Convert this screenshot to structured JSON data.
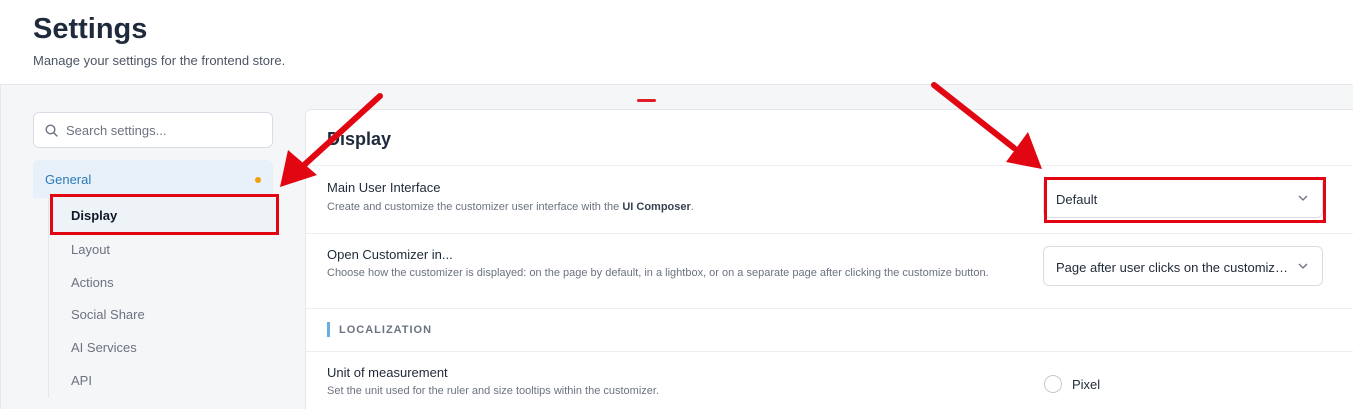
{
  "header": {
    "title": "Settings",
    "subtitle": "Manage your settings for the frontend store."
  },
  "sidebar": {
    "search_placeholder": "Search settings...",
    "group": {
      "label": "General",
      "has_indicator": true,
      "indicator_color": "#f59e0b"
    },
    "items": [
      {
        "label": "Display",
        "active": true
      },
      {
        "label": "Layout"
      },
      {
        "label": "Actions"
      },
      {
        "label": "Social Share"
      },
      {
        "label": "AI Services"
      },
      {
        "label": "API"
      }
    ]
  },
  "panel": {
    "title": "Display",
    "main_ui": {
      "title": "Main User Interface",
      "desc_prefix": "Create and customize the customizer user interface with the ",
      "desc_bold": "UI Composer",
      "desc_suffix": ".",
      "value": "Default"
    },
    "open_customizer": {
      "title": "Open Customizer in...",
      "desc": "Choose how the customizer is displayed: on the page by default, in a lightbox, or on a separate page after clicking the customize button.",
      "value": "Page after user clicks on the customize button"
    },
    "section": {
      "label": "LOCALIZATION"
    },
    "unit": {
      "title": "Unit of measurement",
      "desc": "Set the unit used for the ruler and size tooltips within the customizer.",
      "option": "Pixel"
    }
  },
  "colors": {
    "accent": "#2b7bb9",
    "annotation": "#e10612",
    "section_bar": "#6aaee0"
  }
}
